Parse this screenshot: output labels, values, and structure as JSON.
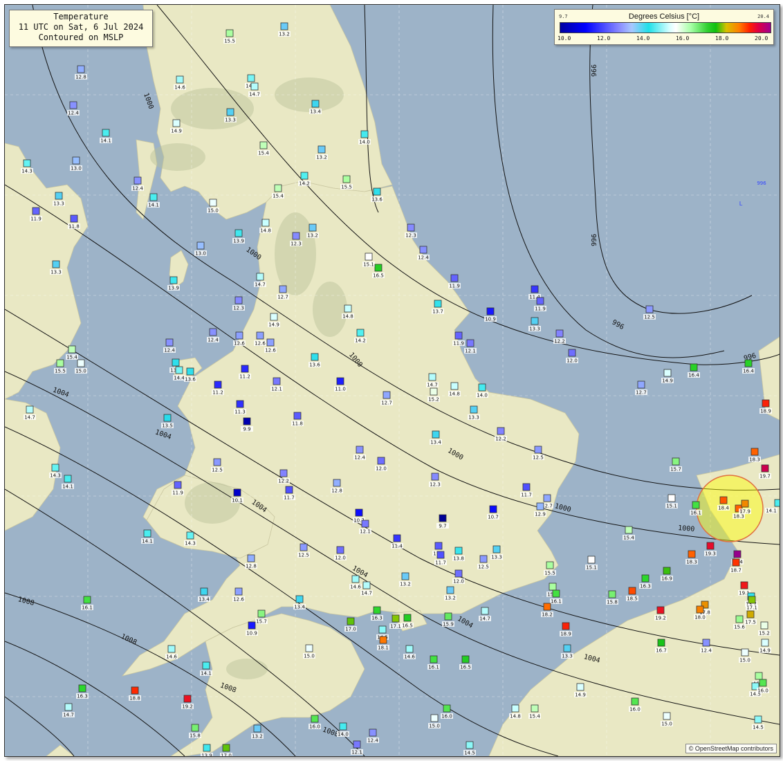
{
  "title": {
    "line1": "Temperature",
    "line2": "11 UTC on Sat, 6 Jul 2024",
    "line3": "Contoured on MSLP"
  },
  "legend": {
    "title": "Degrees Celsius [°C]",
    "min": "9.7",
    "max": "20.4",
    "ticks": [
      "10.0",
      "12.0",
      "14.0",
      "16.0",
      "18.0",
      "20.0"
    ]
  },
  "attribution": "© OpenStreetMap contributors",
  "isobar_labels": [
    "1000",
    "996",
    "1004",
    "1008"
  ],
  "pressure_low": {
    "value": "996",
    "symbol": "L"
  },
  "stations": [
    {
      "t": "12.8"
    },
    {
      "t": "13.2"
    },
    {
      "t": "15.5"
    },
    {
      "t": "14.4"
    },
    {
      "t": "14.7"
    },
    {
      "t": "14.6"
    },
    {
      "t": "12.4"
    },
    {
      "t": "14.1"
    },
    {
      "t": "14.9"
    },
    {
      "t": "13.3"
    },
    {
      "t": "13.4"
    },
    {
      "t": "14.0"
    },
    {
      "t": "15.4"
    },
    {
      "t": "13.2"
    },
    {
      "t": "14.3"
    },
    {
      "t": "13.0"
    },
    {
      "t": "12.4"
    },
    {
      "t": "14.1"
    },
    {
      "t": "15.0"
    },
    {
      "t": "14.2"
    },
    {
      "t": "15.5"
    },
    {
      "t": "15.4"
    },
    {
      "t": "13.6"
    },
    {
      "t": "13.3"
    },
    {
      "t": "11.9"
    },
    {
      "t": "11.8"
    },
    {
      "t": "14.8"
    },
    {
      "t": "13.9"
    },
    {
      "t": "12.3"
    },
    {
      "t": "13.2"
    },
    {
      "t": "12.3"
    },
    {
      "t": "13.0"
    },
    {
      "t": "15.1"
    },
    {
      "t": "16.5"
    },
    {
      "t": "12.4"
    },
    {
      "t": "13.3"
    },
    {
      "t": "13.9"
    },
    {
      "t": "14.7"
    },
    {
      "t": "11.9"
    },
    {
      "t": "12.7"
    },
    {
      "t": "12.3"
    },
    {
      "t": "14.9"
    },
    {
      "t": "14.8"
    },
    {
      "t": "13.7"
    },
    {
      "t": "11.4"
    },
    {
      "t": "11.9"
    },
    {
      "t": "10.9"
    },
    {
      "t": "12.5"
    },
    {
      "t": "12.4"
    },
    {
      "t": "12.4"
    },
    {
      "t": "12.6"
    },
    {
      "t": "14.2"
    },
    {
      "t": "11.9"
    },
    {
      "t": "13.3"
    },
    {
      "t": "12.2"
    },
    {
      "t": "12.1"
    },
    {
      "t": "12.0"
    },
    {
      "t": "15.4"
    },
    {
      "t": "15.5"
    },
    {
      "t": "15.0"
    },
    {
      "t": "13.6"
    },
    {
      "t": "14.4"
    },
    {
      "t": "13.6"
    },
    {
      "t": "11.2"
    },
    {
      "t": "12.1"
    },
    {
      "t": "13.6"
    },
    {
      "t": "11.0"
    },
    {
      "t": "14.7"
    },
    {
      "t": "14.8"
    },
    {
      "t": "14.0"
    },
    {
      "t": "16.4"
    },
    {
      "t": "16.4"
    },
    {
      "t": "14.9"
    },
    {
      "t": "12.7"
    },
    {
      "t": "11.2"
    },
    {
      "t": "12.7"
    },
    {
      "t": "15.2"
    },
    {
      "t": "12.6"
    },
    {
      "t": "12.6"
    },
    {
      "t": "14.7"
    },
    {
      "t": "11.3"
    },
    {
      "t": "9.9"
    },
    {
      "t": "11.8"
    },
    {
      "t": "13.5"
    },
    {
      "t": "13.3"
    },
    {
      "t": "12.2"
    },
    {
      "t": "13.4"
    },
    {
      "t": "18.9"
    },
    {
      "t": "12.4"
    },
    {
      "t": "12.0"
    },
    {
      "t": "12.5"
    },
    {
      "t": "15.7"
    },
    {
      "t": "18.3"
    },
    {
      "t": "19.7"
    },
    {
      "t": "14.3"
    },
    {
      "t": "14.1"
    },
    {
      "t": "12.5"
    },
    {
      "t": "11.9"
    },
    {
      "t": "10.1"
    },
    {
      "t": "12.2"
    },
    {
      "t": "11.7"
    },
    {
      "t": "12.8"
    },
    {
      "t": "12.3"
    },
    {
      "t": "11.7"
    },
    {
      "t": "12.7"
    },
    {
      "t": "12.9"
    },
    {
      "t": "15.1"
    },
    {
      "t": "16.1"
    },
    {
      "t": "18.4"
    },
    {
      "t": "18.3"
    },
    {
      "t": "17.9"
    },
    {
      "t": "10.7"
    },
    {
      "t": "12.1"
    },
    {
      "t": "10.7"
    },
    {
      "t": "9.7"
    },
    {
      "t": "14.1"
    },
    {
      "t": "14.3"
    },
    {
      "t": "11.4"
    },
    {
      "t": "15.4"
    },
    {
      "t": "12.5"
    },
    {
      "t": "12.0"
    },
    {
      "t": "11.8"
    },
    {
      "t": "11.7"
    },
    {
      "t": "13.8"
    },
    {
      "t": "12.5"
    },
    {
      "t": "13.3"
    },
    {
      "t": "18.3"
    },
    {
      "t": "19.3"
    },
    {
      "t": "20.4"
    },
    {
      "t": "18.7"
    },
    {
      "t": "12.8"
    },
    {
      "t": "15.5"
    },
    {
      "t": "15.1"
    },
    {
      "t": "16.9"
    },
    {
      "t": "16.3"
    },
    {
      "t": "13.2"
    },
    {
      "t": "13.2"
    },
    {
      "t": "12.0"
    },
    {
      "t": "14.6"
    },
    {
      "t": "14.7"
    },
    {
      "t": "13.4"
    },
    {
      "t": "12.6"
    },
    {
      "t": "15.5"
    },
    {
      "t": "16.1"
    },
    {
      "t": "15.8"
    },
    {
      "t": "18.5"
    },
    {
      "t": "19.1"
    },
    {
      "t": "13.7"
    },
    {
      "t": "16.1"
    },
    {
      "t": "13.4"
    },
    {
      "t": "15.7"
    },
    {
      "t": "10.9"
    },
    {
      "t": "16.3"
    },
    {
      "t": "17.0"
    },
    {
      "t": "17.1"
    },
    {
      "t": "16.5"
    },
    {
      "t": "15.9"
    },
    {
      "t": "14.7"
    },
    {
      "t": "18.2"
    },
    {
      "t": "19.2"
    },
    {
      "t": "17.8"
    },
    {
      "t": "18.0"
    },
    {
      "t": "17.5"
    },
    {
      "t": "15.6"
    },
    {
      "t": "15.2"
    },
    {
      "t": "14.5"
    },
    {
      "t": "18.1"
    },
    {
      "t": "18.9"
    },
    {
      "t": "16.7"
    },
    {
      "t": "12.4"
    },
    {
      "t": "15.0"
    },
    {
      "t": "14.6"
    },
    {
      "t": "15.0"
    },
    {
      "t": "14.6"
    },
    {
      "t": "16.1"
    },
    {
      "t": "16.5"
    },
    {
      "t": "13.3"
    },
    {
      "t": "14.9"
    },
    {
      "t": "14.9"
    },
    {
      "t": "14.1"
    },
    {
      "t": "15.5"
    },
    {
      "t": "14.5"
    },
    {
      "t": "16.3"
    },
    {
      "t": "18.8"
    },
    {
      "t": "19.2"
    },
    {
      "t": "16.0"
    },
    {
      "t": "15.0"
    },
    {
      "t": "14.7"
    },
    {
      "t": "14.8"
    },
    {
      "t": "15.0"
    },
    {
      "t": "16.0"
    },
    {
      "t": "16.0"
    },
    {
      "t": "15.4"
    },
    {
      "t": "15.8"
    },
    {
      "t": "14.5"
    },
    {
      "t": "13.2"
    },
    {
      "t": "14.0"
    },
    {
      "t": "12.4"
    },
    {
      "t": "12.1"
    },
    {
      "t": "13.9"
    },
    {
      "t": "17.0"
    },
    {
      "t": "14.5"
    },
    {
      "t": "16.0"
    },
    {
      "t": "14.1"
    },
    {
      "t": "17.1"
    },
    {
      "t": "18.1"
    }
  ]
}
